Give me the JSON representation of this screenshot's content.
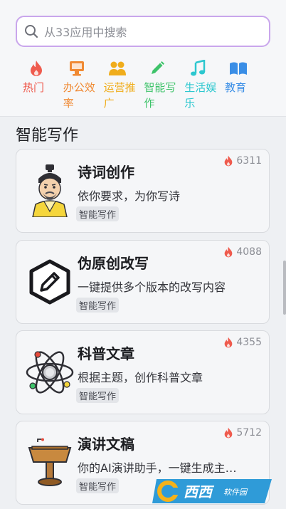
{
  "search": {
    "placeholder": "从33应用中搜索"
  },
  "categories": [
    {
      "label": "热门",
      "color": "#ef5b4e",
      "icon": "fire-icon"
    },
    {
      "label": "办公效率",
      "color": "#f08a34",
      "icon": "monitor-icon"
    },
    {
      "label": "运营推广",
      "color": "#f0ad1c",
      "icon": "people-icon"
    },
    {
      "label": "智能写作",
      "color": "#3ec36a",
      "icon": "pencil-icon"
    },
    {
      "label": "生活娱乐",
      "color": "#2cc7cf",
      "icon": "music-icon"
    },
    {
      "label": "教育",
      "color": "#3a8ee6",
      "icon": "book-icon"
    }
  ],
  "section": {
    "title": "智能写作"
  },
  "cards": [
    {
      "title": "诗词创作",
      "desc": "依你要求，为你写诗",
      "tag": "智能写作",
      "count": "6311",
      "icon": "poet-avatar-icon"
    },
    {
      "title": "伪原创改写",
      "desc": "一键提供多个版本的改写内容",
      "tag": "智能写作",
      "count": "4088",
      "icon": "edit-hexagon-icon"
    },
    {
      "title": "科普文章",
      "desc": "根据主题，创作科普文章",
      "tag": "智能写作",
      "count": "4355",
      "icon": "atom-icon"
    },
    {
      "title": "演讲文稿",
      "desc": "你的AI演讲助手，一键生成主…",
      "tag": "智能写作",
      "count": "5712",
      "icon": "podium-icon"
    }
  ],
  "watermark": {
    "text": "西西",
    "sub": "软件园"
  },
  "colors": {
    "search_border": "#c9a6ec",
    "fire": "#ef5b4e"
  }
}
